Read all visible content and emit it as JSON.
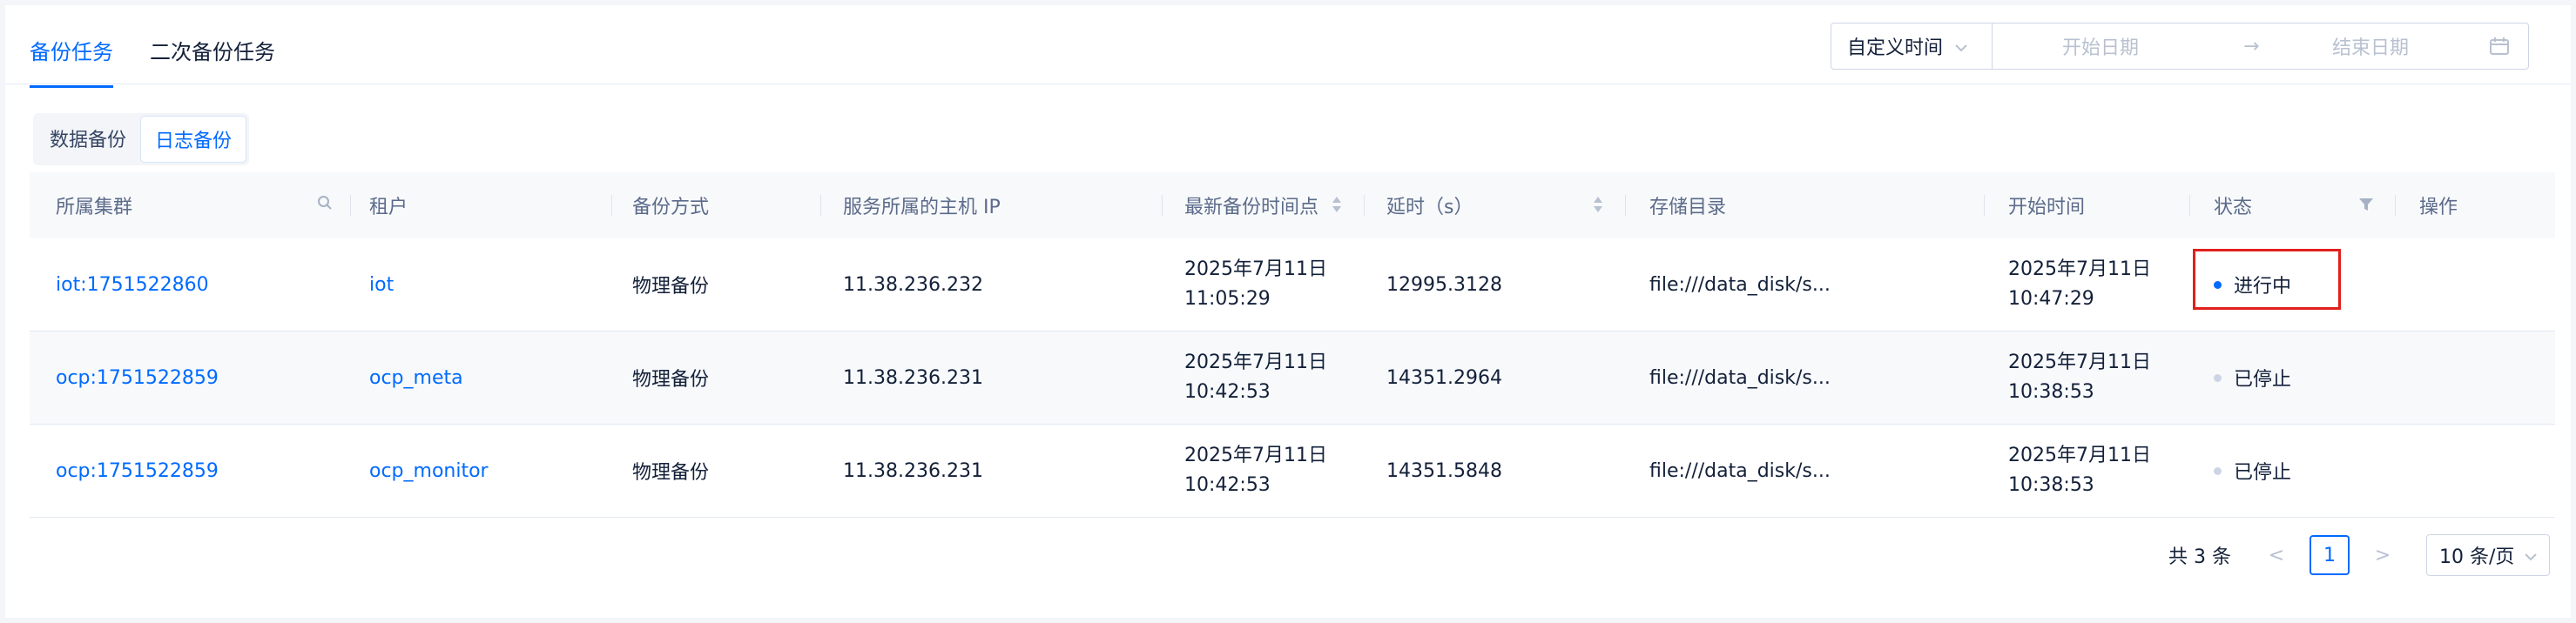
{
  "tabs": [
    {
      "label": "备份任务",
      "active": true
    },
    {
      "label": "二次备份任务",
      "active": false
    }
  ],
  "time_filter": {
    "mode": "自定义时间",
    "start_placeholder": "开始日期",
    "arrow": "→",
    "end_placeholder": "结束日期"
  },
  "segments": [
    {
      "label": "数据备份",
      "active": false
    },
    {
      "label": "日志备份",
      "active": true
    }
  ],
  "columns": [
    "所属集群",
    "租户",
    "备份方式",
    "服务所属的主机 IP",
    "最新备份时间点",
    "延时（s）",
    "存储目录",
    "开始时间",
    "状态",
    "操作"
  ],
  "rows": [
    {
      "cluster": "iot:1751522860",
      "tenant": "iot",
      "method": "物理备份",
      "ip": "11.38.236.232",
      "latest_date": "2025年7月11日",
      "latest_time": "11:05:29",
      "delay": "12995.3128",
      "storage": "file:///data_disk/s...",
      "start_date": "2025年7月11日",
      "start_time": "10:47:29",
      "status": "进行中",
      "status_color": "#006aff"
    },
    {
      "cluster": "ocp:1751522859",
      "tenant": "ocp_meta",
      "method": "物理备份",
      "ip": "11.38.236.231",
      "latest_date": "2025年7月11日",
      "latest_time": "10:42:53",
      "delay": "14351.2964",
      "storage": "file:///data_disk/s...",
      "start_date": "2025年7月11日",
      "start_time": "10:38:53",
      "status": "已停止",
      "status_color": "#cdd5e4"
    },
    {
      "cluster": "ocp:1751522859",
      "tenant": "ocp_monitor",
      "method": "物理备份",
      "ip": "11.38.236.231",
      "latest_date": "2025年7月11日",
      "latest_time": "10:42:53",
      "delay": "14351.5848",
      "storage": "file:///data_disk/s...",
      "start_date": "2025年7月11日",
      "start_time": "10:38:53",
      "status": "已停止",
      "status_color": "#cdd5e4"
    }
  ],
  "pagination": {
    "total": "共 3 条",
    "prev": "<",
    "current": "1",
    "next": ">",
    "page_size": "10 条/页"
  },
  "colors": {
    "accent": "#006aff",
    "highlight": "#e0201c"
  }
}
